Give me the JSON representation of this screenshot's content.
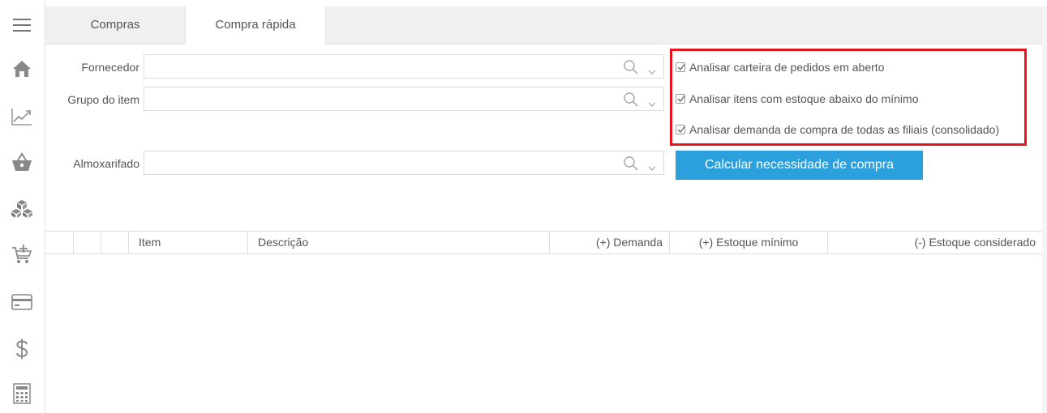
{
  "tabs": [
    {
      "label": "Compras"
    },
    {
      "label": "Compra rápida"
    }
  ],
  "form": {
    "fornecedor_label": "Fornecedor",
    "grupo_label": "Grupo do item",
    "almoxarifado_label": "Almoxarifado",
    "fornecedor_value": "",
    "grupo_value": "",
    "almoxarifado_value": ""
  },
  "options": [
    {
      "label": "Analisar carteira de pedidos em aberto",
      "checked": true
    },
    {
      "label": "Analisar itens com estoque abaixo do mínimo",
      "checked": true
    },
    {
      "label": "Analisar demanda de compra de todas as filiais (consolidado)",
      "checked": true
    }
  ],
  "button": {
    "calc_label": "Calcular necessidade de compra"
  },
  "grid": {
    "columns": [
      "Item",
      "Descrição",
      "(+) Demanda",
      "(+) Estoque mínimo",
      "(-) Estoque considerado"
    ],
    "rows": []
  },
  "sidebar": {
    "icons": [
      "menu-icon",
      "home-icon",
      "chart-icon",
      "basket-icon",
      "boxes-icon",
      "cart-add-icon",
      "card-icon",
      "dollar-icon",
      "calculator-icon"
    ]
  },
  "colors": {
    "accent": "#2ca0dc",
    "highlight": "#e8141c"
  }
}
